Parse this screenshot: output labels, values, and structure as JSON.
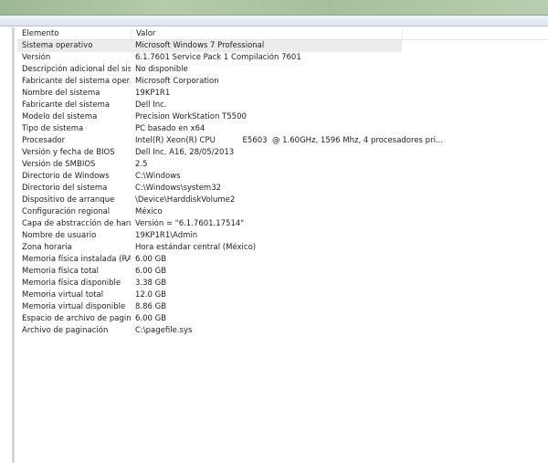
{
  "columns": {
    "element": "Elemento",
    "value": "Valor"
  },
  "rows": [
    {
      "element": "Sistema operativo",
      "value": "Microsoft Windows 7 Professional"
    },
    {
      "element": "Versión",
      "value": "6.1.7601 Service Pack 1 Compilación 7601"
    },
    {
      "element": "Descripción adicional del siste...",
      "value": "No disponible"
    },
    {
      "element": "Fabricante del sistema operativo",
      "value": "Microsoft Corporation"
    },
    {
      "element": "Nombre del sistema",
      "value": "19KP1R1"
    },
    {
      "element": "Fabricante del sistema",
      "value": "Dell Inc."
    },
    {
      "element": "Modelo del sistema",
      "value": "Precision WorkStation T5500"
    },
    {
      "element": "Tipo de sistema",
      "value": "PC basado en x64"
    },
    {
      "element": "Procesador",
      "value": "Intel(R) Xeon(R) CPU           E5603  @ 1.60GHz, 1596 Mhz, 4 procesadores pri..."
    },
    {
      "element": "Versión y fecha de BIOS",
      "value": "Dell Inc. A16, 28/05/2013"
    },
    {
      "element": "Versión de SMBIOS",
      "value": "2.5"
    },
    {
      "element": "Directorio de Windows",
      "value": "C:\\Windows"
    },
    {
      "element": "Directorio del sistema",
      "value": "C:\\Windows\\system32"
    },
    {
      "element": "Dispositivo de arranque",
      "value": "\\Device\\HarddiskVolume2"
    },
    {
      "element": "Configuración regional",
      "value": "México"
    },
    {
      "element": "Capa de abstracción de hardw...",
      "value": "Versión = \"6.1.7601.17514\""
    },
    {
      "element": "Nombre de usuario",
      "value": "19KP1R1\\Admin"
    },
    {
      "element": "Zona horaria",
      "value": "Hora estándar central (México)"
    },
    {
      "element": "Memoria física instalada (RAM)",
      "value": "6.00 GB"
    },
    {
      "element": "Memoria física total",
      "value": "6.00 GB"
    },
    {
      "element": "Memoria física disponible",
      "value": "3.38 GB"
    },
    {
      "element": "Memoria virtual total",
      "value": "12.0 GB"
    },
    {
      "element": "Memoria virtual disponible",
      "value": "8.86 GB"
    },
    {
      "element": "Espacio de archivo de paginaci...",
      "value": "6.00 GB"
    },
    {
      "element": "Archivo de paginación",
      "value": "C:\\pagefile.sys"
    }
  ]
}
